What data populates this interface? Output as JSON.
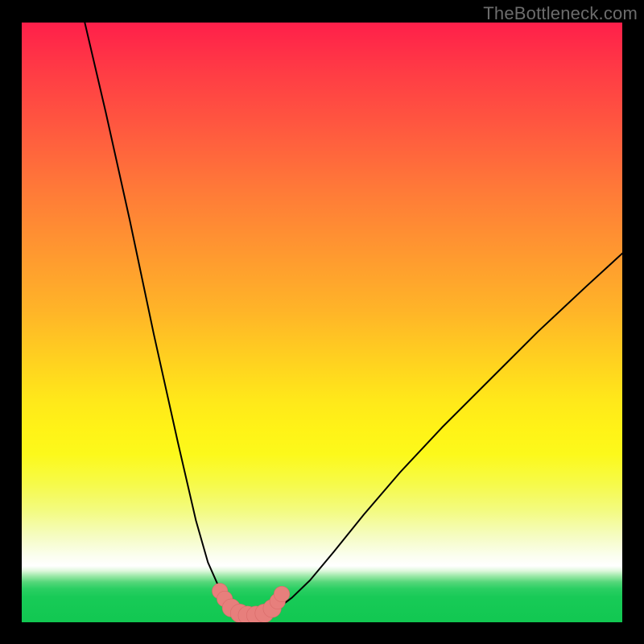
{
  "watermark": "TheBottleneck.com",
  "colors": {
    "frame": "#000000",
    "curve": "#000000",
    "markers_fill": "#e77f7c",
    "markers_stroke": "#d86a68",
    "watermark": "#6c6c6c"
  },
  "chart_data": {
    "type": "line",
    "title": "",
    "xlabel": "",
    "ylabel": "",
    "xlim": [
      0,
      100
    ],
    "ylim": [
      0,
      100
    ],
    "series": [
      {
        "name": "left-curve",
        "x": [
          10.5,
          14,
          18,
          22,
          26,
          29,
          31,
          32.5,
          33.8,
          34.8,
          35.6
        ],
        "values": [
          100,
          85,
          67,
          48,
          30,
          17,
          10,
          6.6,
          4.3,
          2.8,
          1.8
        ]
      },
      {
        "name": "right-curve",
        "x": [
          41.5,
          43,
          45,
          48,
          52,
          57,
          63,
          70,
          78,
          86,
          94,
          100
        ],
        "values": [
          1.8,
          2.6,
          4.1,
          7.0,
          11.8,
          18.0,
          25.0,
          32.5,
          40.5,
          48.5,
          56.0,
          61.5
        ]
      },
      {
        "name": "valley-floor",
        "x": [
          35.6,
          36.4,
          37.4,
          38.6,
          40.0,
          41.5
        ],
        "values": [
          1.8,
          1.35,
          1.1,
          1.1,
          1.35,
          1.8
        ]
      }
    ],
    "markers": [
      {
        "x": 33.0,
        "y": 5.2,
        "r": 1.3
      },
      {
        "x": 33.8,
        "y": 3.9,
        "r": 1.3
      },
      {
        "x": 34.9,
        "y": 2.4,
        "r": 1.5
      },
      {
        "x": 36.3,
        "y": 1.5,
        "r": 1.55
      },
      {
        "x": 37.6,
        "y": 1.15,
        "r": 1.55
      },
      {
        "x": 39.0,
        "y": 1.15,
        "r": 1.55
      },
      {
        "x": 40.4,
        "y": 1.5,
        "r": 1.55
      },
      {
        "x": 41.7,
        "y": 2.3,
        "r": 1.5
      },
      {
        "x": 42.6,
        "y": 3.5,
        "r": 1.3
      },
      {
        "x": 43.3,
        "y": 4.7,
        "r": 1.3
      }
    ]
  }
}
